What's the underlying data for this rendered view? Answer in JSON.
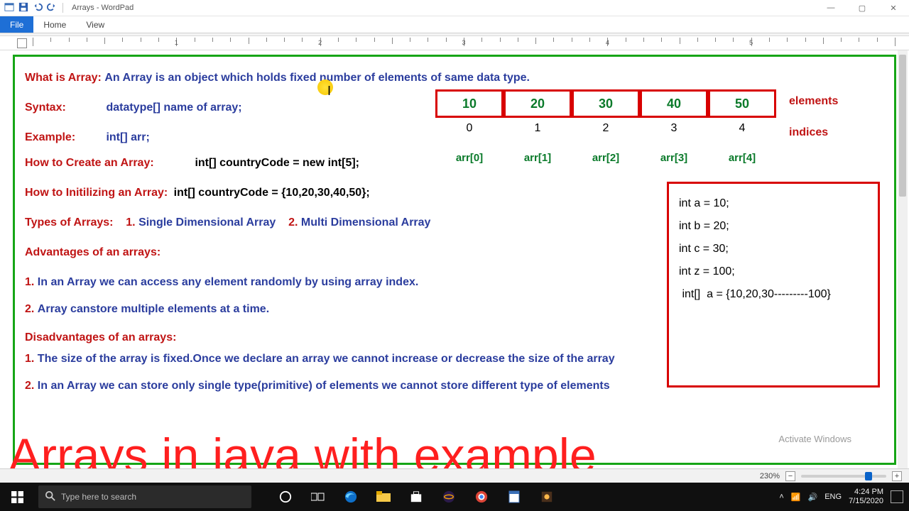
{
  "window": {
    "title": "Arrays - WordPad",
    "tabs": {
      "file": "File",
      "home": "Home",
      "view": "View"
    }
  },
  "ruler": {
    "marks": [
      "1",
      "2",
      "3",
      "4",
      "5"
    ]
  },
  "doc": {
    "what_label": "What is Array:",
    "what_text": " An Array is an object which holds fixed number of elements of same data type.",
    "syntax_label": "Syntax:",
    "syntax_text": "datatype[]   name of array;",
    "example_label": "Example:",
    "example_text": "int[]  arr;",
    "create_label": "How to Create an Array:",
    "create_text": "int[]  countryCode = new int[5];",
    "init_label": "How to Initilizing an Array:",
    "init_text": "int[] countryCode  =  {10,20,30,40,50};",
    "types_label": "Types of Arrays:",
    "types_1_n": "1.",
    "types_1": " Single Dimensional Array",
    "types_2_n": "2.",
    "types_2": " Multi Dimensional Array",
    "adv_label": "Advantages of an arrays:",
    "adv_1_n": "1.",
    "adv_1": " In an Array we can access any element randomly by using array index.",
    "adv_2_n": "2.",
    "adv_2": " Array canstore multiple elements at a time.",
    "dis_label": "Disadvantages of an arrays:",
    "dis_1_n": "1.",
    "dis_1": " The size of the array is fixed.Once we declare an array we cannot increase or decrease the size of the array",
    "dis_2_n": "2.",
    "dis_2": " In an Array we can store only single type(primitive) of elements we cannot store different type of elements"
  },
  "array_diagram": {
    "elements_label": "elements",
    "indices_label": "indices",
    "cells": [
      "10",
      "20",
      "30",
      "40",
      "50"
    ],
    "indices": [
      "0",
      "1",
      "2",
      "3",
      "4"
    ],
    "refs": [
      "arr[0]",
      "arr[1]",
      "arr[2]",
      "arr[3]",
      "arr[4]"
    ]
  },
  "codebox": {
    "l1": "int a = 10;",
    "l2": "int b = 20;",
    "l3": "int c = 30;",
    "l4": "",
    "l5": "int z = 100;",
    "l6": " int[]  a = {10,20,30---------100}"
  },
  "overlay_caption": "Arrays in java with example",
  "watermark": "Activate Windows",
  "status": {
    "zoom": "230%",
    "minus": "−",
    "plus": "+"
  },
  "taskbar": {
    "search_placeholder": "Type here to search",
    "lang": "ENG",
    "time": "4:24 PM",
    "date": "7/15/2020",
    "tray_net": "📶",
    "tray_vol": "🔊"
  }
}
